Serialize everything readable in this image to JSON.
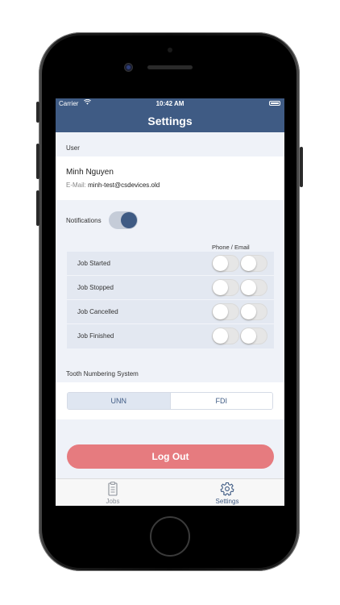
{
  "status_bar": {
    "carrier": "Carrier",
    "time": "10:42 AM"
  },
  "header": {
    "title": "Settings"
  },
  "user_section": {
    "label": "User",
    "name": "Minh Nguyen",
    "email_label": "E-Mail:",
    "email": "minh-test@csdevices.old"
  },
  "notifications": {
    "label": "Notifications",
    "enabled": true
  },
  "job_table": {
    "column_header": "Phone / Email",
    "rows": [
      {
        "label": "Job Started",
        "phone": false,
        "email": false
      },
      {
        "label": "Job Stopped",
        "phone": false,
        "email": false
      },
      {
        "label": "Job Cancelled",
        "phone": false,
        "email": false
      },
      {
        "label": "Job Finished",
        "phone": false,
        "email": false
      }
    ]
  },
  "tooth_numbering": {
    "label": "Tooth Numbering System",
    "options": [
      "UNN",
      "FDI"
    ],
    "selected": "UNN"
  },
  "logout": {
    "label": "Log Out"
  },
  "tabbar": {
    "tabs": [
      {
        "label": "Jobs",
        "icon": "clipboard-icon",
        "active": false
      },
      {
        "label": "Settings",
        "icon": "gear-icon",
        "active": true
      }
    ]
  },
  "colors": {
    "accent": "#3f5b84",
    "logout": "#e67b7f",
    "background": "#eff2f8"
  }
}
